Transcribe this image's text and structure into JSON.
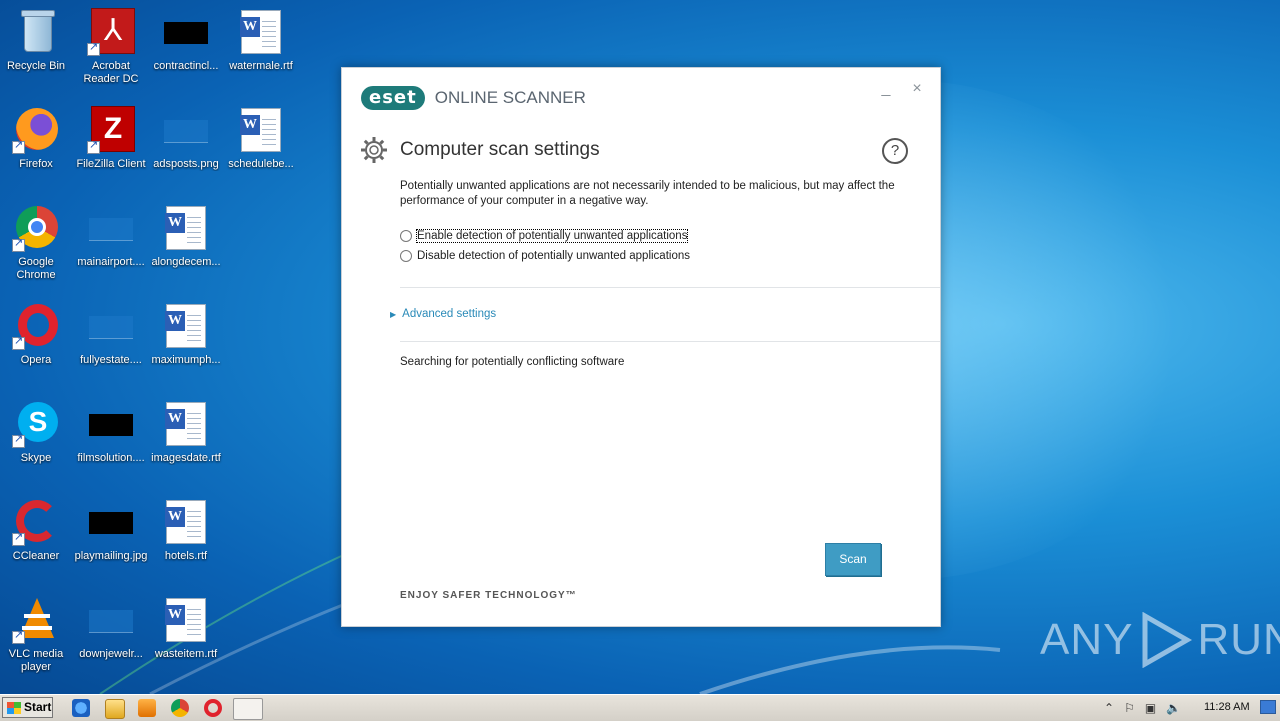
{
  "desktop": {
    "icons": [
      {
        "label": "Recycle Bin"
      },
      {
        "label": "Acrobat Reader DC"
      },
      {
        "label": "contractincl..."
      },
      {
        "label": "watermale.rtf"
      },
      {
        "label": "Firefox"
      },
      {
        "label": "FileZilla Client"
      },
      {
        "label": "adsposts.png"
      },
      {
        "label": "schedulebe..."
      },
      {
        "label": "Google Chrome"
      },
      {
        "label": "mainairport...."
      },
      {
        "label": "alongdecem..."
      },
      {
        "label": "Opera"
      },
      {
        "label": "fullyestate...."
      },
      {
        "label": "maximumph..."
      },
      {
        "label": "Skype"
      },
      {
        "label": "filmsolution...."
      },
      {
        "label": "imagesdate.rtf"
      },
      {
        "label": "CCleaner"
      },
      {
        "label": "playmailing.jpg"
      },
      {
        "label": "hotels.rtf"
      },
      {
        "label": "VLC media player"
      },
      {
        "label": "downjewelr..."
      },
      {
        "label": "wasteitem.rtf"
      }
    ]
  },
  "eset": {
    "logo_badge": "eset",
    "logo_text": "ONLINE SCANNER",
    "title": "Computer scan settings",
    "help": "?",
    "description": "Potentially unwanted applications are not necessarily intended to be malicious, but may affect the performance of your computer in a negative way.",
    "options": [
      {
        "label": "Enable detection of potentially unwanted applications",
        "selected": false
      },
      {
        "label": "Disable detection of potentially unwanted applications",
        "selected": false
      }
    ],
    "advanced_settings": "Advanced settings",
    "status": "Searching for potentially conflicting software",
    "scan_button": "Scan",
    "tagline": "ENJOY SAFER TECHNOLOGY™",
    "minimize": "_",
    "close": "×"
  },
  "watermark": {
    "left": "ANY",
    "right": "RUN"
  },
  "taskbar": {
    "start": "Start",
    "pinned": [
      "internet-explorer-icon",
      "explorer-icon",
      "media-player-icon",
      "chrome-icon",
      "opera-icon",
      "eset-icon"
    ],
    "clock": "11:28 AM"
  }
}
